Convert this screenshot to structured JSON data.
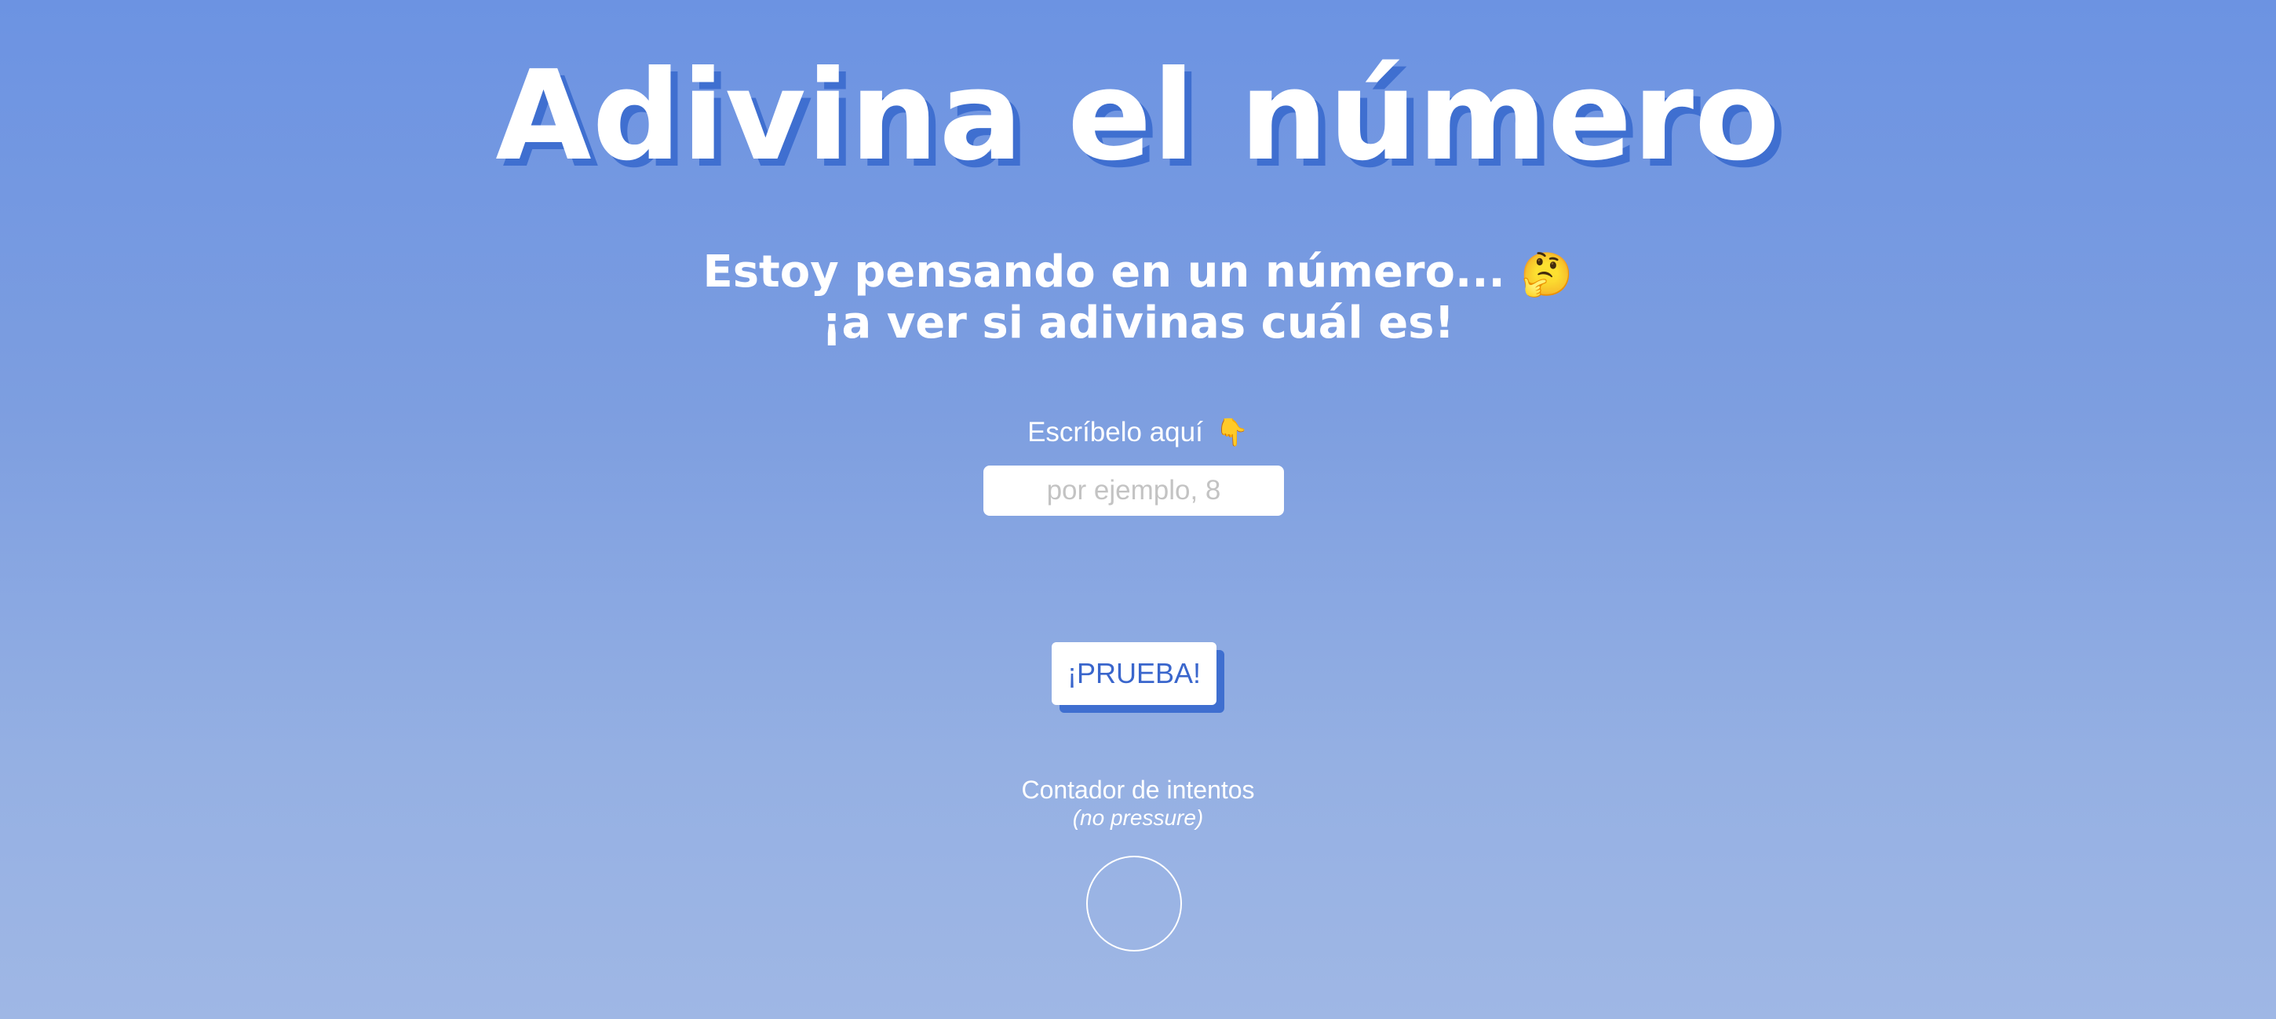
{
  "header": {
    "title": "Adivina el número"
  },
  "intro": {
    "line1": "Estoy pensando en un número...",
    "line1_emoji": "🤔",
    "line2": "¡a ver si adivinas cuál es!"
  },
  "guess_form": {
    "label": "Escríbelo aquí",
    "label_emoji": "👇",
    "input_value": "",
    "input_placeholder": "por ejemplo, 8",
    "submit_label": "¡PRUEBA!"
  },
  "attempts": {
    "label": "Contador de intentos",
    "note": "(no pressure)",
    "count": ""
  },
  "colors": {
    "background_top": "#6c93e2",
    "background_bottom": "#9fb7e5",
    "accent_shadow": "#3f6fd0",
    "button_text": "#3a66cc"
  }
}
